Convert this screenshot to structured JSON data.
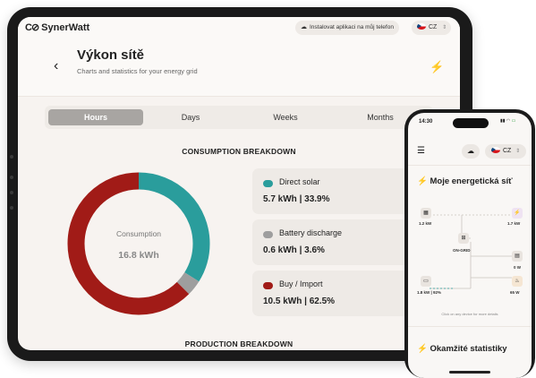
{
  "app": {
    "name": "SynerWatt",
    "install_label": "Instalovat aplikaci na můj telefon",
    "language": "CZ"
  },
  "page": {
    "title": "Výkon sítě",
    "subtitle": "Charts and statistics for your energy grid"
  },
  "tabs": [
    {
      "label": "Hours",
      "active": true
    },
    {
      "label": "Days",
      "active": false
    },
    {
      "label": "Weeks",
      "active": false
    },
    {
      "label": "Months",
      "active": false
    }
  ],
  "consumption": {
    "section_title": "CONSUMPTION BREAKDOWN",
    "center_label": "Consumption",
    "center_value": "16.8 kWh",
    "items": [
      {
        "label": "Direct solar",
        "value": "5.7 kWh | 33.9%",
        "percent": 33.9,
        "color": "#2a9d9c"
      },
      {
        "label": "Battery discharge",
        "value": "0.6 kWh | 3.6%",
        "percent": 3.6,
        "color": "#9e9e9e"
      },
      {
        "label": "Buy / Import",
        "value": "10.5 kWh | 62.5%",
        "percent": 62.5,
        "color": "#a11b17"
      }
    ]
  },
  "production": {
    "section_title": "PRODUCTION BREAKDOWN"
  },
  "phone": {
    "time": "14:30",
    "language": "CZ",
    "grid_title": "Moje energetická síť",
    "nodes": {
      "top_left": "1.2 kW",
      "top_right": "1.7 kW",
      "center": "ON-GRID",
      "right_mid": "0 W",
      "bottom_left": "1.8 kW | 92%",
      "bottom_right": "65 W"
    },
    "hint": "Click on any device for more details",
    "stats_title": "Okamžité statistiky"
  }
}
